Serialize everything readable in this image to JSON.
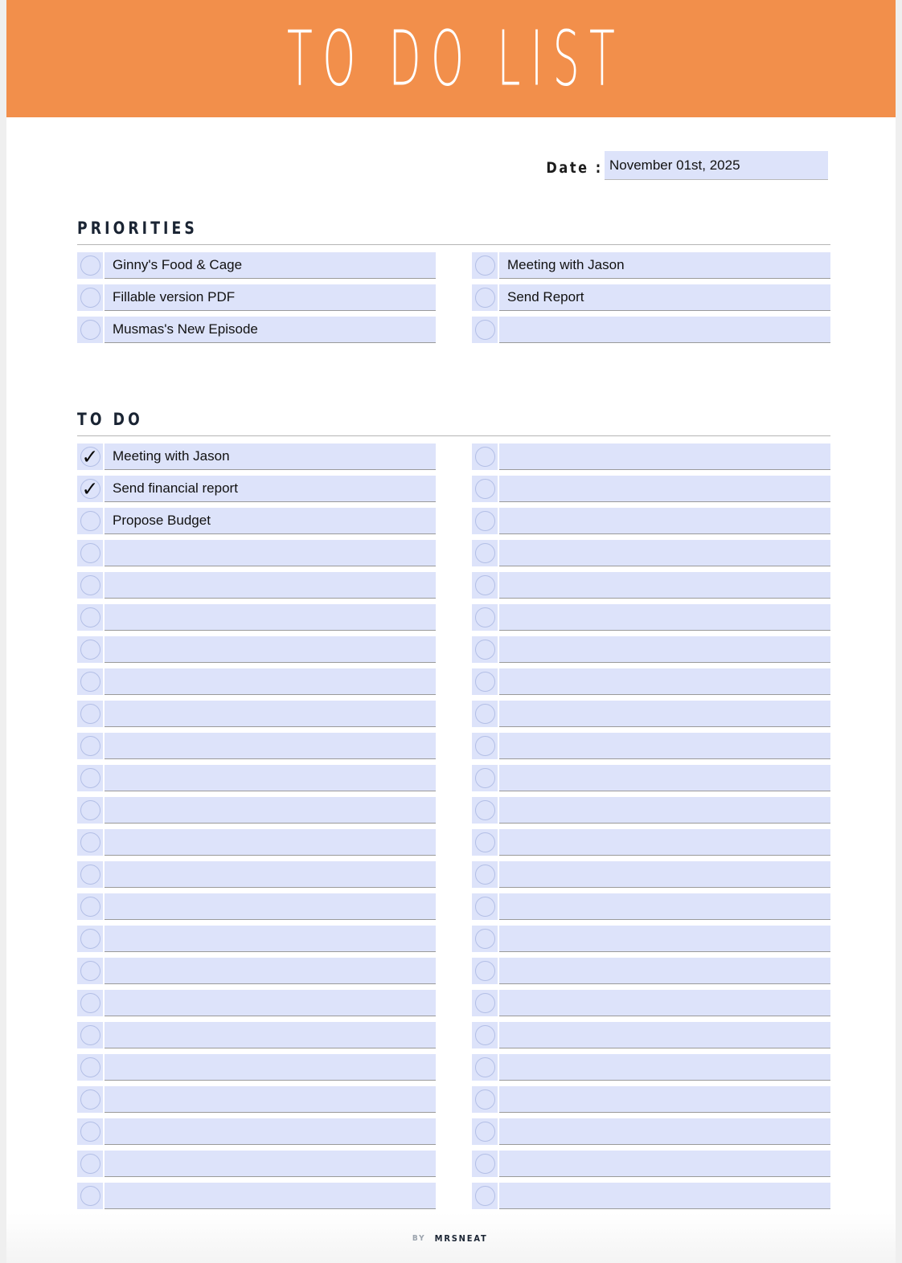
{
  "theme": {
    "banner_color": "#f28f4b",
    "field_fill": "#dde3fa",
    "heading_color": "#1a2433",
    "page_background": "#ffffff",
    "outer_background": "#efefef"
  },
  "header": {
    "title": "TO DO LIST"
  },
  "date": {
    "label": "Date :",
    "value": "November 01st, 2025",
    "placeholder": ""
  },
  "priorities": {
    "heading": "PRIORITIES",
    "left_column": [
      {
        "text": "Ginny's Food & Cage",
        "checked": false
      },
      {
        "text": "Fillable version PDF",
        "checked": false
      },
      {
        "text": "Musmas's New Episode",
        "checked": false
      }
    ],
    "right_column": [
      {
        "text": "Meeting with Jason",
        "checked": false
      },
      {
        "text": "Send Report",
        "checked": false
      },
      {
        "text": "",
        "checked": false
      }
    ]
  },
  "todo": {
    "heading": "TO DO",
    "check_glyph": "✓",
    "left_column": [
      {
        "text": "Meeting with Jason",
        "checked": true
      },
      {
        "text": "Send financial report",
        "checked": true
      },
      {
        "text": "Propose Budget",
        "checked": false
      },
      {
        "text": "",
        "checked": false
      },
      {
        "text": "",
        "checked": false
      },
      {
        "text": "",
        "checked": false
      },
      {
        "text": "",
        "checked": false
      },
      {
        "text": "",
        "checked": false
      },
      {
        "text": "",
        "checked": false
      },
      {
        "text": "",
        "checked": false
      },
      {
        "text": "",
        "checked": false
      },
      {
        "text": "",
        "checked": false
      },
      {
        "text": "",
        "checked": false
      },
      {
        "text": "",
        "checked": false
      },
      {
        "text": "",
        "checked": false
      },
      {
        "text": "",
        "checked": false
      },
      {
        "text": "",
        "checked": false
      },
      {
        "text": "",
        "checked": false
      },
      {
        "text": "",
        "checked": false
      },
      {
        "text": "",
        "checked": false
      },
      {
        "text": "",
        "checked": false
      },
      {
        "text": "",
        "checked": false
      },
      {
        "text": "",
        "checked": false
      },
      {
        "text": "",
        "checked": false
      }
    ],
    "right_column": [
      {
        "text": "",
        "checked": false
      },
      {
        "text": "",
        "checked": false
      },
      {
        "text": "",
        "checked": false
      },
      {
        "text": "",
        "checked": false
      },
      {
        "text": "",
        "checked": false
      },
      {
        "text": "",
        "checked": false
      },
      {
        "text": "",
        "checked": false
      },
      {
        "text": "",
        "checked": false
      },
      {
        "text": "",
        "checked": false
      },
      {
        "text": "",
        "checked": false
      },
      {
        "text": "",
        "checked": false
      },
      {
        "text": "",
        "checked": false
      },
      {
        "text": "",
        "checked": false
      },
      {
        "text": "",
        "checked": false
      },
      {
        "text": "",
        "checked": false
      },
      {
        "text": "",
        "checked": false
      },
      {
        "text": "",
        "checked": false
      },
      {
        "text": "",
        "checked": false
      },
      {
        "text": "",
        "checked": false
      },
      {
        "text": "",
        "checked": false
      },
      {
        "text": "",
        "checked": false
      },
      {
        "text": "",
        "checked": false
      },
      {
        "text": "",
        "checked": false
      },
      {
        "text": "",
        "checked": false
      }
    ]
  },
  "footer": {
    "by": "BY",
    "brand": "MRSNEAT"
  }
}
